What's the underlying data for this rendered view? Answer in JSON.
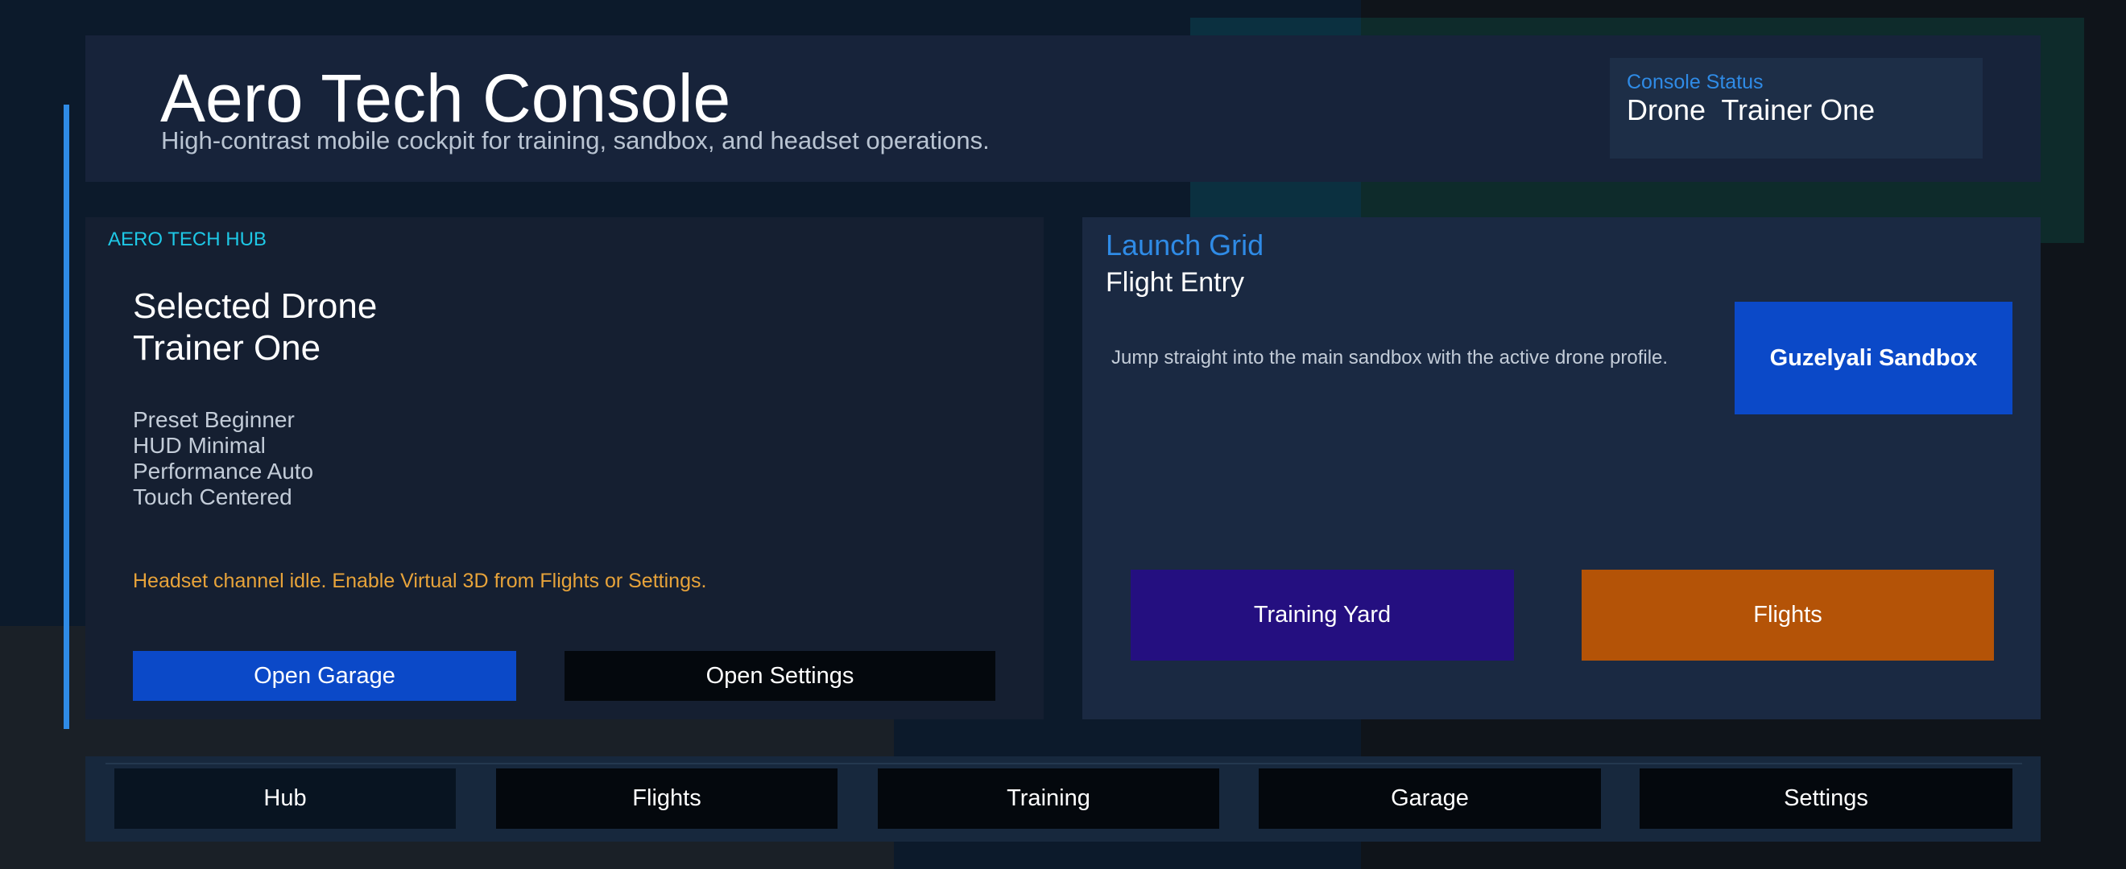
{
  "header": {
    "title": "Aero Tech Console",
    "subtitle": "High-contrast mobile cockpit for training, sandbox, and headset operations."
  },
  "status": {
    "label": "Console Status",
    "value": "Drone  Trainer One"
  },
  "hub": {
    "eyebrow": "AERO TECH HUB",
    "selected_line1": "Selected Drone",
    "selected_line2": "Trainer One",
    "details": [
      "Preset Beginner",
      "HUD Minimal",
      "Performance Auto",
      "Touch Centered"
    ],
    "warning": "Headset channel idle. Enable Virtual 3D from Flights or Settings.",
    "open_garage": "Open Garage",
    "open_settings": "Open Settings"
  },
  "launch": {
    "title": "Launch Grid",
    "subtitle": "Flight Entry",
    "description": "Jump straight into the main sandbox with the active drone profile.",
    "sandbox_button": "Guzelyali Sandbox",
    "training_yard_button": "Training Yard",
    "flights_button": "Flights"
  },
  "nav": {
    "items": [
      "Hub",
      "Flights",
      "Training",
      "Garage",
      "Settings"
    ],
    "active": "Hub"
  },
  "colors": {
    "accent_blue": "#2f8be6",
    "primary_button": "#0b49c8",
    "warning": "#e7a33a",
    "training_yard": "#240f80",
    "flights": "#b45307",
    "eyebrow": "#1ec8e6"
  }
}
